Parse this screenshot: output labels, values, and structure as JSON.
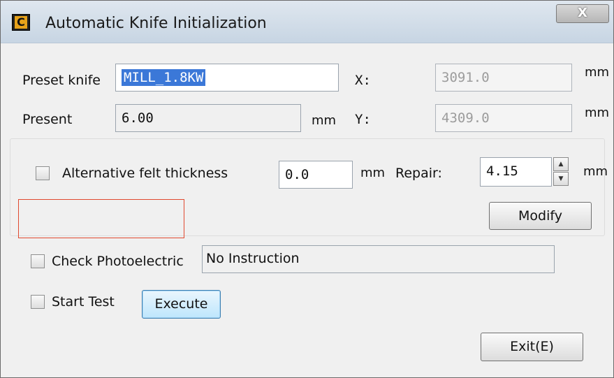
{
  "window": {
    "title": "Automatic Knife Initialization",
    "icon_letter": "C",
    "close_label": "X"
  },
  "fields": {
    "preset_knife": {
      "label": "Preset knife",
      "value": "MILL_1.8KW"
    },
    "present": {
      "label": "Present",
      "value": "6.00",
      "unit": "mm"
    },
    "x": {
      "label": "X:",
      "value": "3091.0",
      "unit": "mm"
    },
    "y": {
      "label": "Y:",
      "value": "4309.0",
      "unit": "mm"
    }
  },
  "group": {
    "alt_felt_label": "Alternative felt thickness",
    "alt_felt_value": "0.0",
    "alt_felt_unit": "mm",
    "repair_label": "Repair:",
    "repair_value": "4.15",
    "repair_unit": "mm",
    "modify_label": "Modify"
  },
  "photo": {
    "label": "Check Photoelectric",
    "instruction": "No Instruction"
  },
  "test": {
    "label": "Start Test",
    "execute_label": "Execute"
  },
  "exit_label": "Exit(E)"
}
